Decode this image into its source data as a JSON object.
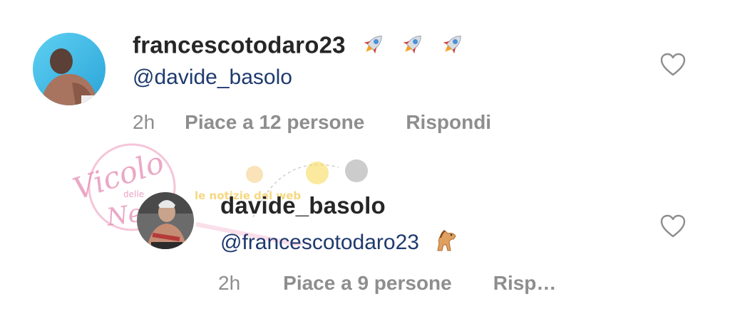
{
  "comments": [
    {
      "username": "francescotodaro23",
      "mention": "@davide_basolo",
      "time": "2h",
      "likes": "Piace a 12 persone",
      "reply": "Rispondi",
      "emoji": "rocket-icon"
    },
    {
      "username": "davide_basolo",
      "mention": "@francescotodaro23",
      "time": "2h",
      "likes": "Piace a 9 persone",
      "reply": "Risp…",
      "emoji": "horse-icon"
    }
  ],
  "watermark": {
    "script_text": "Vicolo",
    "small_text": "delle",
    "script_text2": "News",
    "banner_text": "le notizie del web"
  },
  "colors": {
    "username": "#262626",
    "mention": "#1e3a6e",
    "meta": "#8e8e8e",
    "watermark_pink": "#e58bb4"
  }
}
